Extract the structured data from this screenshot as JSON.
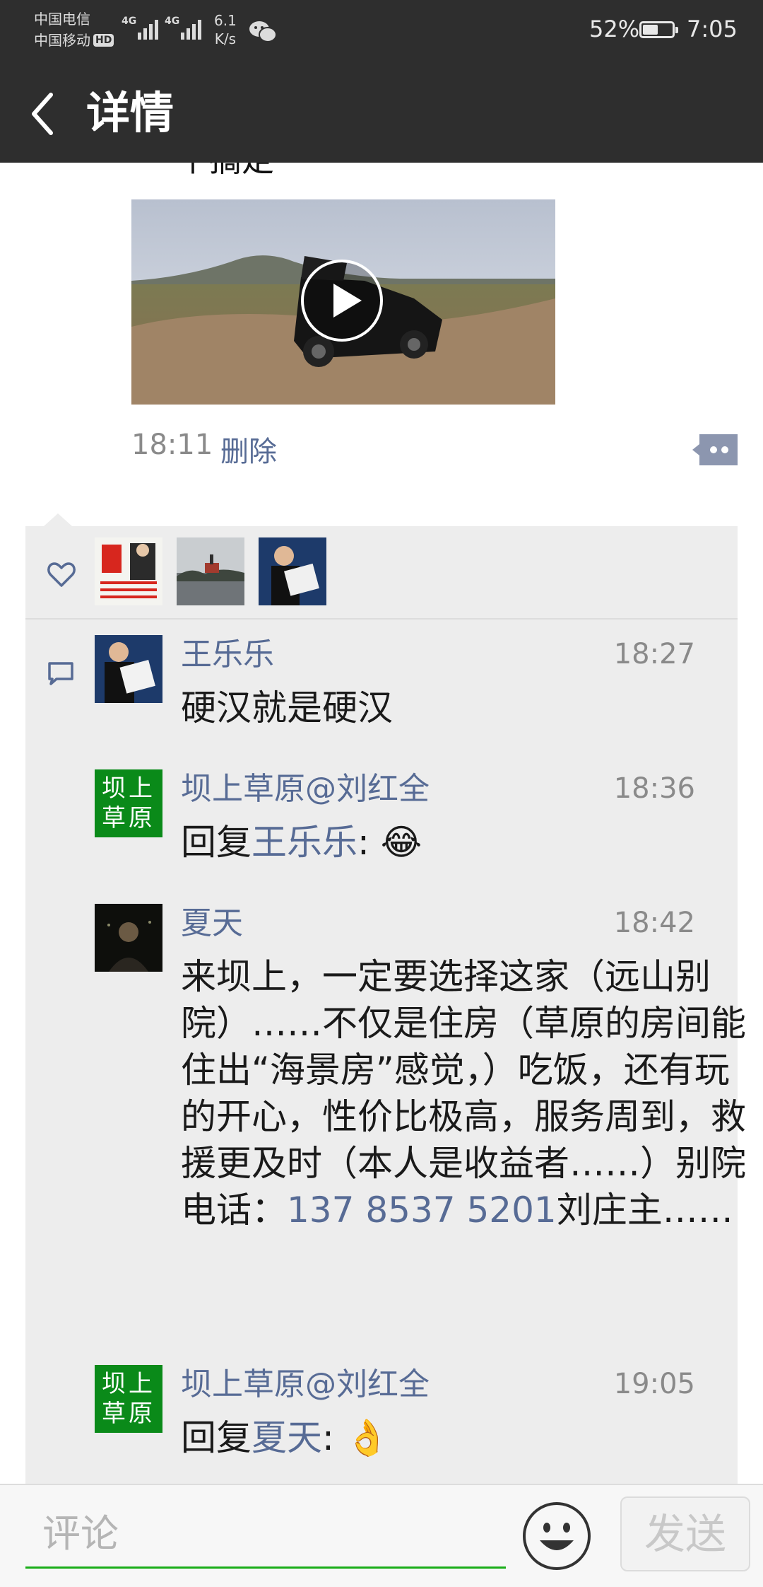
{
  "status_bar": {
    "carrier_1": "中国电信",
    "carrier_2": "中国移动",
    "hd_label": "HD",
    "signal_1_label": "4G",
    "signal_2_label": "4G",
    "net_speed_value": "6.1",
    "net_speed_unit": "K/s",
    "battery_percent": "52%",
    "battery_level": 0.52,
    "time": "7:05"
  },
  "nav": {
    "title": "详情"
  },
  "post": {
    "truncated_text": "个搞定",
    "time": "18:11",
    "delete_label": "删除"
  },
  "comments": [
    {
      "name": "王乐乐",
      "time": "18:27",
      "text": "硬汉就是硬汉"
    },
    {
      "name": "坝上草原@刘红全",
      "time": "18:36",
      "reply_prefix": "回复",
      "reply_to": "王乐乐",
      "reply_sep": ":",
      "emoji": "😂",
      "avatar_text_1": "坝上",
      "avatar_text_2": "草原"
    },
    {
      "name": "夏天",
      "time": "18:42",
      "text_before_phone": "来坝上，一定要选择这家（远山别院）……不仅是住房（草原的房间能住出“海景房”感觉，）吃饭，还有玩的开心，性价比极高，服务周到，救援更及时（本人是收益者……）别院电话：",
      "phone": "137 8537 5201",
      "text_after_phone": "刘庄主……"
    },
    {
      "name": "坝上草原@刘红全",
      "time": "19:05",
      "reply_prefix": "回复",
      "reply_to": "夏天",
      "reply_sep": ":",
      "emoji": "👌",
      "avatar_text_1": "坝上",
      "avatar_text_2": "草原"
    }
  ],
  "input_bar": {
    "placeholder": "评论",
    "send_label": "发送"
  },
  "colors": {
    "status_bar_bg": "#2e2e2e",
    "link_blue": "#576b95",
    "comment_bg": "#ededed",
    "input_underline": "#1aad19",
    "brand_green": "#0a8a19"
  }
}
